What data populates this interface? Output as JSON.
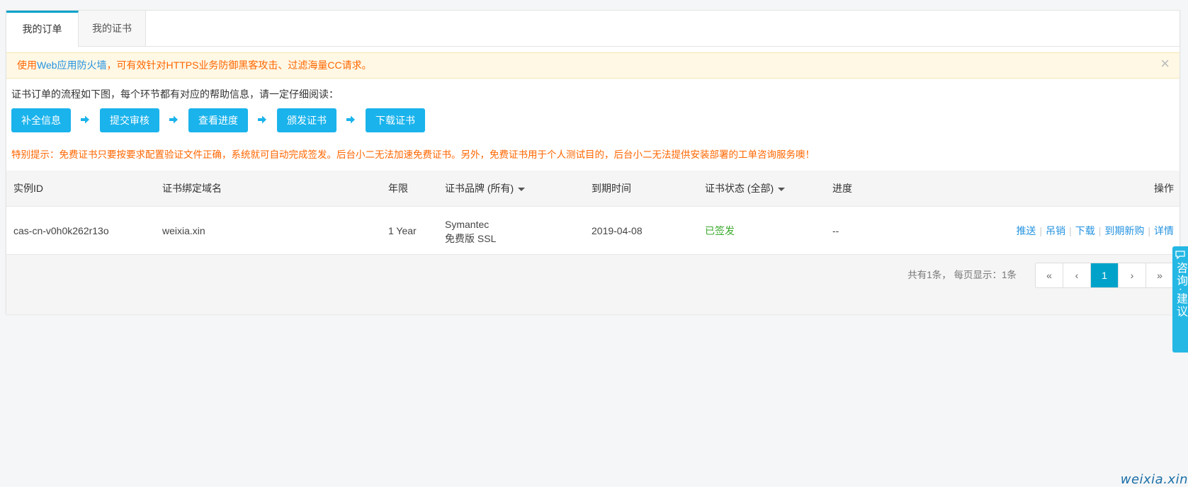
{
  "tabs": [
    {
      "label": "我的订单",
      "active": true
    },
    {
      "label": "我的证书",
      "active": false
    }
  ],
  "alert": {
    "prefix": "使用",
    "link": "Web应用防火墙",
    "suffix": "，可有效针对HTTPS业务防御黑客攻击、过滤海量CC请求。",
    "close": "×"
  },
  "flow": {
    "intro": "证书订单的流程如下图，每个环节都有对应的帮助信息，请一定仔细阅读：",
    "steps": [
      "补全信息",
      "提交审核",
      "查看进度",
      "颁发证书",
      "下载证书"
    ]
  },
  "warning": "特别提示：免费证书只要按要求配置验证文件正确，系统就可自动完成签发。后台小二无法加速免费证书。另外，免费证书用于个人测试目的，后台小二无法提供安装部署的工单咨询服务噢！",
  "table": {
    "headers": {
      "instance_id": "实例ID",
      "domain": "证书绑定域名",
      "term": "年限",
      "brand": "证书品牌 (所有)",
      "expire": "到期时间",
      "status": "证书状态 (全部)",
      "progress": "进度",
      "actions": "操作"
    },
    "rows": [
      {
        "instance_id": "cas-cn-v0h0k262r13o",
        "domain": "weixia.xin",
        "term": "1 Year",
        "brand_line1": "Symantec",
        "brand_line2": "免费版 SSL",
        "expire": "2019-04-08",
        "status": "已签发",
        "progress": "--",
        "actions": [
          "推送",
          "吊销",
          "下载",
          "到期新购",
          "详情"
        ]
      }
    ]
  },
  "pagination": {
    "info": "共有1条， 每页显示：1条",
    "first": "«",
    "prev": "‹",
    "current": "1",
    "next": "›",
    "last": "»"
  },
  "side_button": {
    "label": "咨询·建议",
    "icon": "chat-icon"
  },
  "watermark": "weixia.xin",
  "colors": {
    "accent": "#00a2ca",
    "flow_button": "#1ab3ec",
    "link": "#2493e1",
    "warning": "#ff6600",
    "success": "#3aa92b",
    "alert_bg": "#fff8e5"
  }
}
